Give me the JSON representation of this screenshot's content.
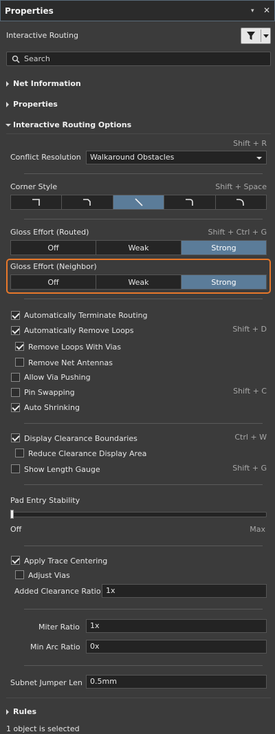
{
  "panel": {
    "title": "Properties",
    "pin_glyph": "▾",
    "close_glyph": "✕"
  },
  "top": {
    "mode_label": "Interactive Routing",
    "filter_icon": "filter-icon"
  },
  "search": {
    "placeholder": "Search"
  },
  "sections": {
    "net_information": "Net Information",
    "properties": "Properties",
    "iro": "Interactive Routing Options",
    "rules": "Rules"
  },
  "conflict": {
    "shortcut": "Shift + R",
    "label": "Conflict Resolution",
    "value": "Walkaround Obstacles"
  },
  "corner": {
    "label": "Corner Style",
    "shortcut": "Shift + Space"
  },
  "gloss_routed": {
    "label": "Gloss Effort (Routed)",
    "shortcut": "Shift + Ctrl + G",
    "options": [
      "Off",
      "Weak",
      "Strong"
    ],
    "selected": "Strong"
  },
  "gloss_neighbor": {
    "label": "Gloss Effort (Neighbor)",
    "options": [
      "Off",
      "Weak",
      "Strong"
    ],
    "selected": "Strong"
  },
  "checks": {
    "auto_terminate": "Automatically Terminate Routing",
    "auto_remove_loops": "Automatically Remove Loops",
    "auto_remove_loops_sc": "Shift + D",
    "remove_loops_vias": "Remove Loops With Vias",
    "remove_net_antennas": "Remove Net Antennas",
    "allow_via_pushing": "Allow Via Pushing",
    "pin_swapping": "Pin Swapping",
    "pin_swapping_sc": "Shift + C",
    "auto_shrinking": "Auto Shrinking",
    "display_clearance": "Display Clearance Boundaries",
    "display_clearance_sc": "Ctrl + W",
    "reduce_clearance": "Reduce Clearance Display Area",
    "show_length_gauge": "Show Length Gauge",
    "show_length_gauge_sc": "Shift + G",
    "apply_trace_centering": "Apply Trace Centering",
    "adjust_vias": "Adjust Vias"
  },
  "pad_entry": {
    "label": "Pad Entry Stability",
    "min": "Off",
    "max": "Max",
    "level": 0.0
  },
  "fields": {
    "added_clearance_label": "Added Clearance Ratio",
    "added_clearance_value": "1x",
    "miter_label": "Miter Ratio",
    "miter_value": "1x",
    "min_arc_label": "Min Arc Ratio",
    "min_arc_value": "0x",
    "subnet_label": "Subnet Jumper Len",
    "subnet_value": "0.5mm"
  },
  "status": {
    "text": "1 object is selected"
  },
  "colors": {
    "selected": "#5b7c99",
    "highlight": "#e8782a"
  }
}
